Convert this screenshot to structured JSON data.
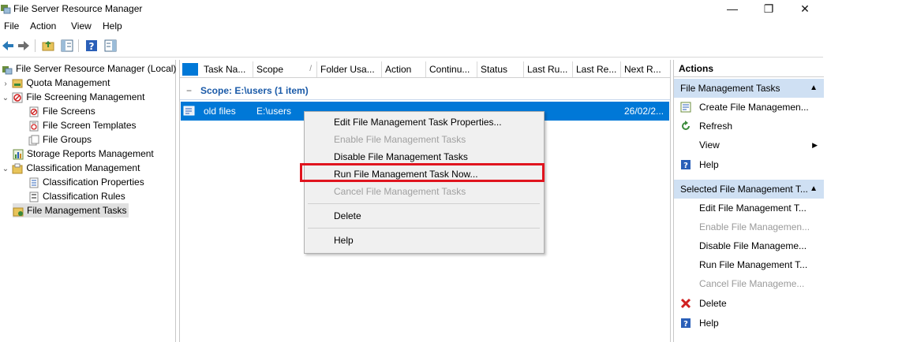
{
  "window": {
    "title": "File Server Resource Manager",
    "controls": {
      "minimize": "—",
      "maximize": "❐",
      "close": "✕"
    }
  },
  "menu": [
    "File",
    "Action",
    "View",
    "Help"
  ],
  "tree": [
    {
      "label": "File Server Resource Manager (Local)",
      "icon": "server-icon"
    },
    {
      "label": "Quota Management",
      "icon": "quota-icon",
      "arrow": ">"
    },
    {
      "label": "File Screening Management",
      "icon": "screening-icon",
      "arrow": "v"
    },
    {
      "label": "File Screens",
      "icon": "file-screen-icon"
    },
    {
      "label": "File Screen Templates",
      "icon": "template-icon"
    },
    {
      "label": "File Groups",
      "icon": "file-group-icon"
    },
    {
      "label": "Storage Reports Management",
      "icon": "reports-icon"
    },
    {
      "label": "Classification Management",
      "icon": "classification-icon",
      "arrow": "v"
    },
    {
      "label": "Classification Properties",
      "icon": "properties-icon"
    },
    {
      "label": "Classification Rules",
      "icon": "rules-icon"
    },
    {
      "label": "File Management Tasks",
      "icon": "tasks-icon",
      "selected": true
    }
  ],
  "list": {
    "columns": [
      "Task Na...",
      "Scope",
      "Folder Usa...",
      "Action",
      "Continu...",
      "Status",
      "Last Ru...",
      "Last Re...",
      "Next R..."
    ],
    "group_label": "Scope: E:\\users (1 item)",
    "row": {
      "name": "old files",
      "scope": "E:\\users",
      "next_run": "26/02/2..."
    }
  },
  "context_menu": {
    "items": [
      {
        "label": "Edit File Management Task Properties...",
        "enabled": true
      },
      {
        "label": "Enable File Management Tasks",
        "enabled": false
      },
      {
        "label": "Disable File Management Tasks",
        "enabled": true
      },
      {
        "label": "Run File Management Task Now...",
        "enabled": true,
        "highlighted": true
      },
      {
        "label": "Cancel File Management Tasks",
        "enabled": false
      },
      {
        "label": "Delete",
        "enabled": true
      },
      {
        "label": "Help",
        "enabled": true
      }
    ]
  },
  "actions": {
    "title": "Actions",
    "group1": {
      "label": "File Management Tasks",
      "items": [
        {
          "label": "Create File Managemen...",
          "icon": "create-icon"
        },
        {
          "label": "Refresh",
          "icon": "refresh-icon"
        },
        {
          "label": "View",
          "submenu": true
        },
        {
          "label": "Help",
          "icon": "help-icon"
        }
      ]
    },
    "group2": {
      "label": "Selected File Management T...",
      "items": [
        {
          "label": "Edit File Management T...",
          "enabled": true
        },
        {
          "label": "Enable File Managemen...",
          "enabled": false
        },
        {
          "label": "Disable File Manageme...",
          "enabled": true
        },
        {
          "label": "Run File Management T...",
          "enabled": true
        },
        {
          "label": "Cancel File Manageme...",
          "enabled": false
        },
        {
          "label": "Delete",
          "icon": "delete-icon",
          "enabled": true
        },
        {
          "label": "Help",
          "icon": "help-icon",
          "enabled": true
        }
      ]
    }
  },
  "colors": {
    "selection": "#0078d7",
    "accent_header": "#cfe0f3",
    "highlight_border": "#e0141e"
  }
}
